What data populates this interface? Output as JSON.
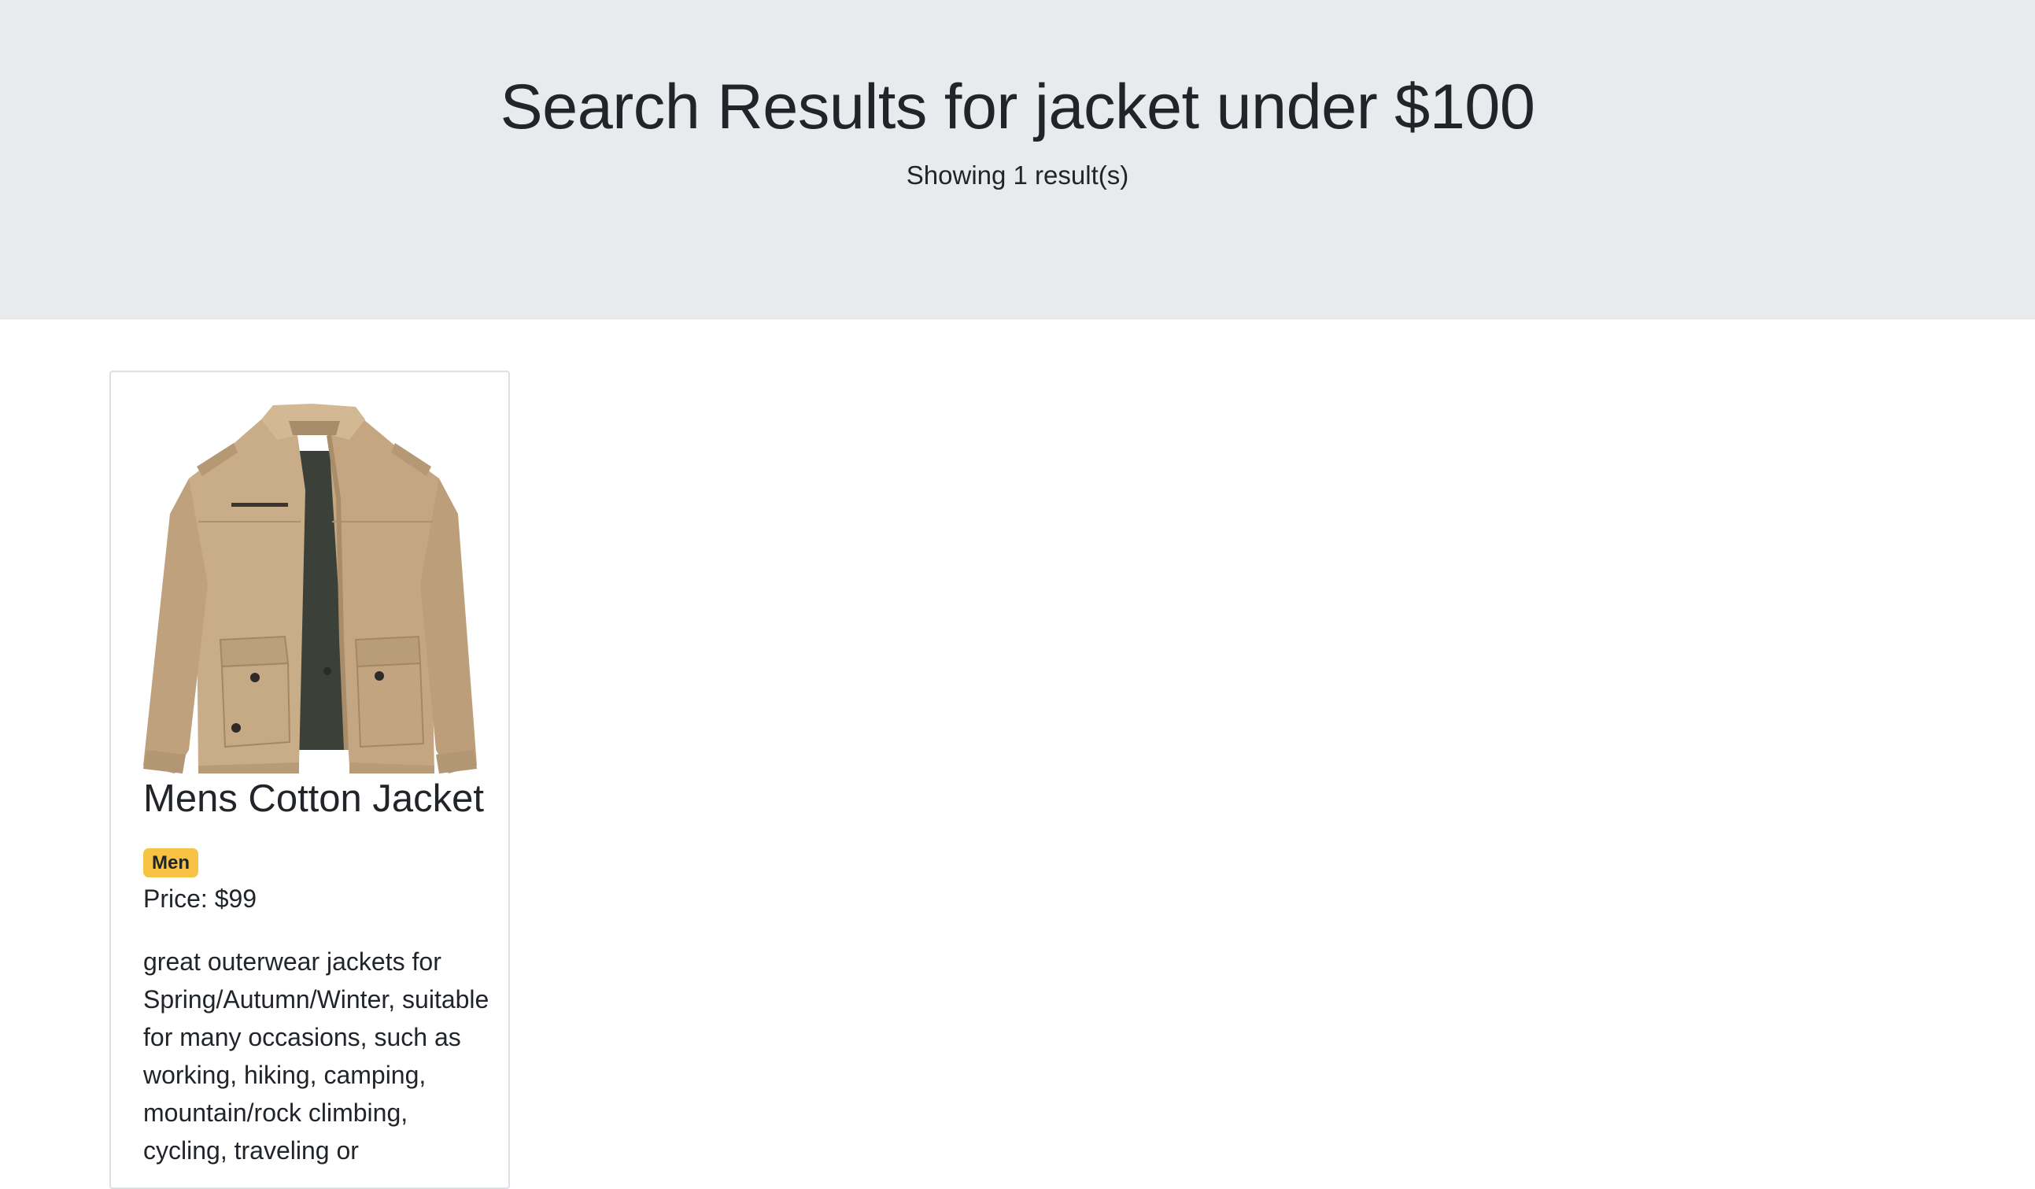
{
  "header": {
    "title": "Search Results for jacket under $100",
    "result_count": "Showing 1 result(s)"
  },
  "results": [
    {
      "name": "Mens Cotton Jacket",
      "category": "Men",
      "price_text": "Price: $99",
      "description": "great outerwear jackets for Spring/Autumn/Winter, suitable for many occasions, such as working, hiking, camping, mountain/rock climbing, cycling, traveling or",
      "image_icon": "khaki-jacket-image"
    }
  ],
  "colors": {
    "hero_bg": "#e9eaee",
    "badge_bg": "#f7c344",
    "card_border": "#dcdfe3",
    "text": "#212529"
  }
}
